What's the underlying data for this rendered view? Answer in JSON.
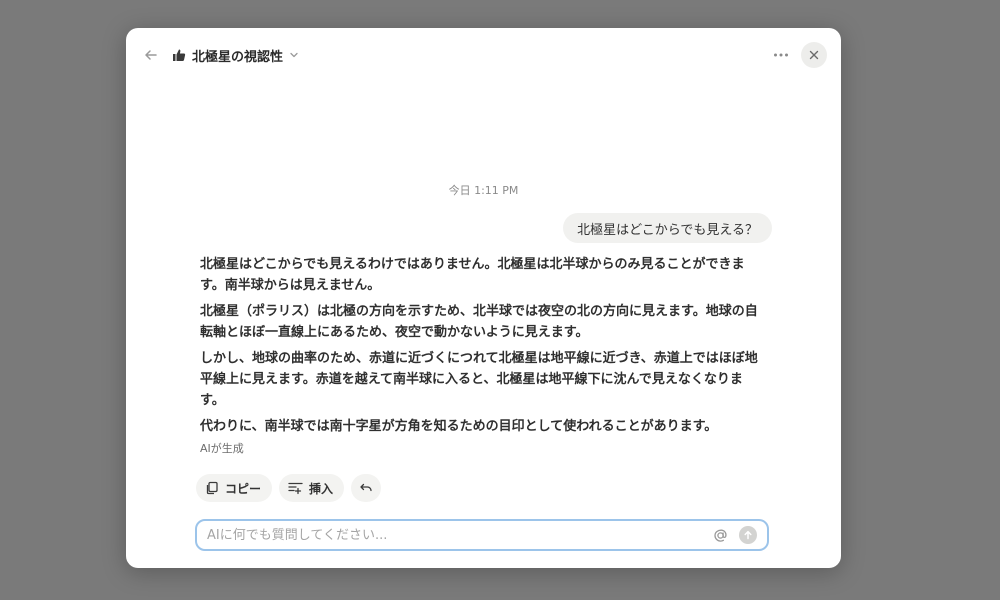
{
  "header": {
    "title": "北極星の視認性"
  },
  "chat": {
    "timestamp": "今日 1:11 PM",
    "user_message": "北極星はどこからでも見える？",
    "answer_paragraphs": [
      "北極星はどこからでも見えるわけではありません。北極星は北半球からのみ見ることができます。南半球からは見えません。",
      "北極星（ポラリス）は北極の方向を示すため、北半球では夜空の北の方向に見えます。地球の自転軸とほぼ一直線上にあるため、夜空で動かないように見えます。",
      "しかし、地球の曲率のため、赤道に近づくにつれて北極星は地平線に近づき、赤道上ではほぼ地平線上に見えます。赤道を越えて南半球に入ると、北極星は地平線下に沈んで見えなくなります。",
      "代わりに、南半球では南十字星が方角を知るための目印として使われることがあります。"
    ],
    "ai_label": "AIが生成"
  },
  "actions": {
    "copy_label": "コピー",
    "insert_label": "挿入"
  },
  "input": {
    "value": "",
    "placeholder": "AIに何でも質問してください..."
  },
  "icons": {
    "title_icon": "thumbs-up-icon",
    "back": "arrow-left-icon",
    "more": "more-horizontal-icon",
    "close": "close-icon",
    "copy": "copy-icon",
    "insert": "insert-icon",
    "retry": "undo-icon",
    "mention": "at-sign-icon",
    "send": "arrow-up-icon"
  },
  "colors": {
    "backdrop": "#7a7a7a",
    "input_border": "#9cc4ea",
    "bubble": "#f1f1ef"
  }
}
